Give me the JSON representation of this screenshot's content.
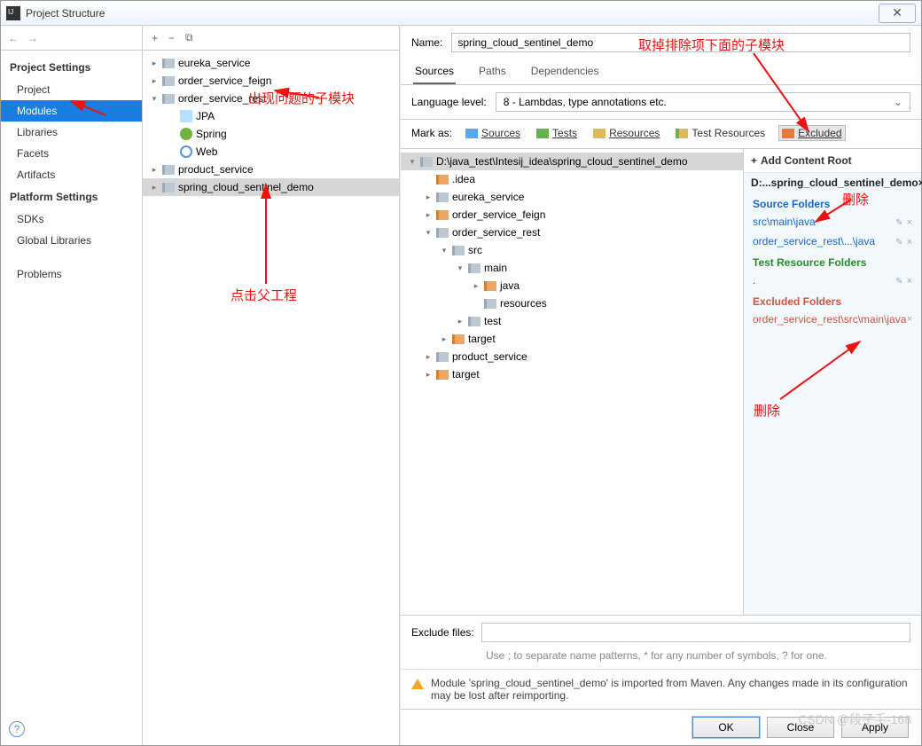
{
  "window": {
    "title": "Project Structure",
    "close_glyph": "✕"
  },
  "nav": {
    "back": "←",
    "fwd": "→"
  },
  "sidebar": {
    "project_settings_head": "Project Settings",
    "platform_settings_head": "Platform Settings",
    "items": {
      "project": "Project",
      "modules": "Modules",
      "libraries": "Libraries",
      "facets": "Facets",
      "artifacts": "Artifacts",
      "sdks": "SDKs",
      "global_libs": "Global Libraries",
      "problems": "Problems"
    }
  },
  "mid_tools": {
    "plus": "+",
    "minus": "−",
    "copy": "⧉"
  },
  "module_tree": [
    {
      "label": "eureka_service",
      "depth": 0,
      "icon": "folder",
      "tog": "▸"
    },
    {
      "label": "order_service_feign",
      "depth": 0,
      "icon": "folder",
      "tog": "▸"
    },
    {
      "label": "order_service_rest",
      "depth": 0,
      "icon": "folder",
      "tog": "▾"
    },
    {
      "label": "JPA",
      "depth": 1,
      "icon": "jpa",
      "tog": ""
    },
    {
      "label": "Spring",
      "depth": 1,
      "icon": "spring",
      "tog": ""
    },
    {
      "label": "Web",
      "depth": 1,
      "icon": "web",
      "tog": ""
    },
    {
      "label": "product_service",
      "depth": 0,
      "icon": "folder",
      "tog": "▸"
    },
    {
      "label": "spring_cloud_sentinel_demo",
      "depth": 0,
      "icon": "folder",
      "selected": true,
      "tog": "▸"
    }
  ],
  "form": {
    "name_label": "Name:",
    "name_value": "spring_cloud_sentinel_demo",
    "tabs": {
      "sources": "Sources",
      "paths": "Paths",
      "deps": "Dependencies"
    },
    "lang_label": "Language level:",
    "lang_value": "8 - Lambdas, type annotations etc.",
    "mark_label": "Mark as:",
    "mark": {
      "sources": "Sources",
      "tests": "Tests",
      "resources": "Resources",
      "test_resources": "Test Resources",
      "excluded": "Excluded"
    }
  },
  "dir_tree": [
    {
      "label": "D:\\java_test\\Intesij_idea\\spring_cloud_sentinel_demo",
      "depth": 0,
      "tog": "▾",
      "sel": true,
      "cls": ""
    },
    {
      "label": ".idea",
      "depth": 1,
      "tog": "",
      "cls": "ex"
    },
    {
      "label": "eureka_service",
      "depth": 1,
      "tog": "▸",
      "cls": ""
    },
    {
      "label": "order_service_feign",
      "depth": 1,
      "tog": "▸",
      "cls": "ex"
    },
    {
      "label": "order_service_rest",
      "depth": 1,
      "tog": "▾",
      "cls": ""
    },
    {
      "label": "src",
      "depth": 2,
      "tog": "▾",
      "cls": ""
    },
    {
      "label": "main",
      "depth": 3,
      "tog": "▾",
      "cls": ""
    },
    {
      "label": "java",
      "depth": 4,
      "tog": "▸",
      "cls": "ex"
    },
    {
      "label": "resources",
      "depth": 4,
      "tog": "",
      "cls": ""
    },
    {
      "label": "test",
      "depth": 3,
      "tog": "▸",
      "cls": ""
    },
    {
      "label": "target",
      "depth": 2,
      "tog": "▸",
      "cls": "ex"
    },
    {
      "label": "product_service",
      "depth": 1,
      "tog": "▸",
      "cls": ""
    },
    {
      "label": "target",
      "depth": 1,
      "tog": "▸",
      "cls": "ex"
    }
  ],
  "side_panel": {
    "add_root": "Add Content Root",
    "root_path": "D:...spring_cloud_sentinel_demo",
    "source_head": "Source Folders",
    "sources": [
      "src\\main\\java",
      "order_service_rest\\...\\java"
    ],
    "test_res_head": "Test Resource Folders",
    "test_res_dot": ".",
    "excluded_head": "Excluded Folders",
    "excluded": [
      "order_service_rest\\src\\main\\java"
    ]
  },
  "exclude": {
    "label": "Exclude files:",
    "hint": "Use ; to separate name patterns, * for any number of symbols, ? for one."
  },
  "warn": "Module 'spring_cloud_sentinel_demo' is imported from Maven. Any changes made in its configuration may be lost after reimporting.",
  "buttons": {
    "ok": "OK",
    "close": "Close",
    "apply": "Apply"
  },
  "annotations": {
    "a1": "出现问题的子模块",
    "a2": "点击父工程",
    "a3": "取掉排除项下面的子模块",
    "a4": "删除",
    "a5": "删除"
  },
  "watermark": "CSDN @段子手-168"
}
